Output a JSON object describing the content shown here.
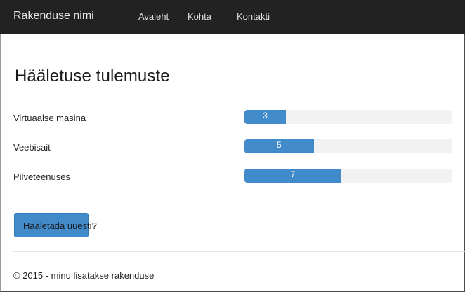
{
  "navbar": {
    "brand": "Rakenduse nimi",
    "links": [
      {
        "label": "Avaleht"
      },
      {
        "label": "Kohta"
      },
      {
        "label": "Kontakti"
      }
    ]
  },
  "page": {
    "title": "Hääletuse tulemuste"
  },
  "results": {
    "scale_max": 15,
    "items": [
      {
        "label": "Virtuaalse masina",
        "votes": 3,
        "votes_text": "3"
      },
      {
        "label": "Veebisait",
        "votes": 5,
        "votes_text": "5"
      },
      {
        "label": "Pilveteenuses",
        "votes": 7,
        "votes_text": "7"
      }
    ]
  },
  "actions": {
    "vote_again_label": "Hääletada uuesti?"
  },
  "colors": {
    "navbar_bg": "#222222",
    "bar_fill": "#428bca",
    "bar_track": "#f2f2f2"
  },
  "footer": {
    "text": "© 2015 - minu lisatakse rakenduse"
  }
}
